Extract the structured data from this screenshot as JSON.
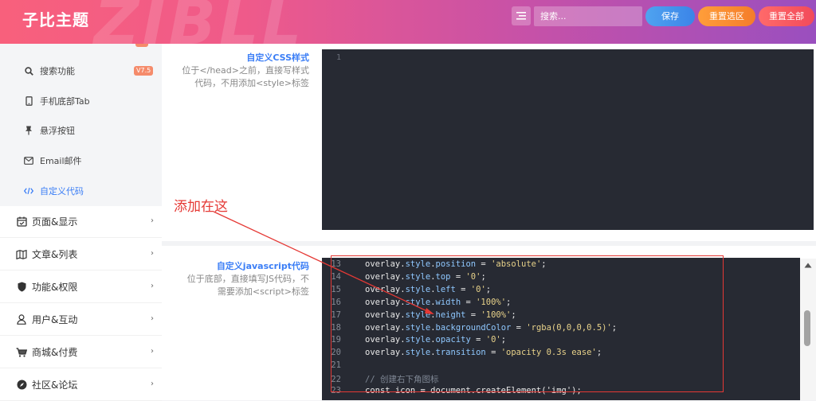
{
  "header": {
    "brand": "子比主题",
    "watermark": "ZIBLL",
    "search_placeholder": "搜索...",
    "save_label": "保存",
    "reset_selection_label": "重置选区",
    "reset_all_label": "重置全部"
  },
  "sidebar": {
    "sub_items": [
      {
        "label": "搜索功能",
        "icon": "search-icon",
        "badge": "V7.5"
      },
      {
        "label": "手机底部Tab",
        "icon": "mobile-icon"
      },
      {
        "label": "悬浮按钮",
        "icon": "pin-icon"
      },
      {
        "label": "Email邮件",
        "icon": "mail-icon"
      },
      {
        "label": "自定义代码",
        "icon": "code-icon",
        "active": true
      }
    ],
    "items": [
      {
        "label": "页面&显示",
        "icon": "calendar-icon"
      },
      {
        "label": "文章&列表",
        "icon": "map-icon"
      },
      {
        "label": "功能&权限",
        "icon": "shield-icon"
      },
      {
        "label": "用户&互动",
        "icon": "user-icon"
      },
      {
        "label": "商城&付费",
        "icon": "cart-icon"
      },
      {
        "label": "社区&论坛",
        "icon": "compass-icon"
      }
    ]
  },
  "css_field": {
    "title": "自定义CSS样式",
    "desc_line1": "位于</head>之前，直接写样式",
    "desc_line2": "代码，不用添加<style>标签",
    "line_number": "1"
  },
  "js_field": {
    "title": "自定义javascript代码",
    "desc_line1": "位于底部，直接填写JS代码，不",
    "desc_line2": "需要添加<script>标签",
    "lines": [
      {
        "n": "13",
        "prop": "position",
        "val": "'absolute'"
      },
      {
        "n": "14",
        "prop": "top",
        "val": "'0'"
      },
      {
        "n": "15",
        "prop": "left",
        "val": "'0'"
      },
      {
        "n": "16",
        "prop": "width",
        "val": "'100%'"
      },
      {
        "n": "17",
        "prop": "height",
        "val": "'100%'"
      },
      {
        "n": "18",
        "prop": "backgroundColor",
        "val": "'rgba(0,0,0,0.5)'"
      },
      {
        "n": "19",
        "prop": "opacity",
        "val": "'0'"
      },
      {
        "n": "20",
        "prop": "transition",
        "val": "'opacity 0.3s ease'"
      }
    ],
    "blank_line_n": "21",
    "comment_line_n": "22",
    "comment": "// 创建右下角图标",
    "last_line_n": "23",
    "last_line_code": "const icon = document.createElement('img');"
  },
  "annotation": "添加在这"
}
